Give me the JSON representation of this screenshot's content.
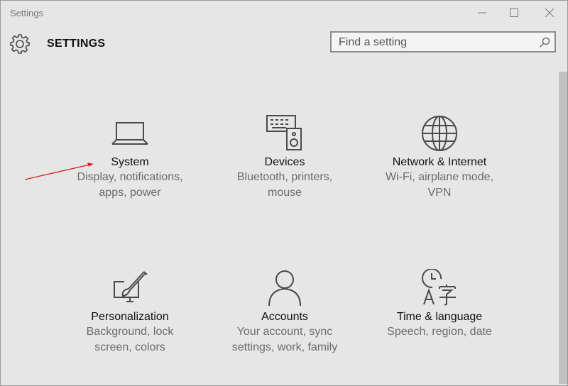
{
  "window": {
    "title": "Settings"
  },
  "header": {
    "title": "SETTINGS"
  },
  "search": {
    "placeholder": "Find a setting"
  },
  "tiles": [
    {
      "title": "System",
      "desc": "Display, notifications, apps, power",
      "icon": "laptop-icon"
    },
    {
      "title": "Devices",
      "desc": "Bluetooth, printers, mouse",
      "icon": "devices-icon"
    },
    {
      "title": "Network & Internet",
      "desc": "Wi-Fi, airplane mode, VPN",
      "icon": "globe-icon"
    },
    {
      "title": "Personalization",
      "desc": "Background, lock screen, colors",
      "icon": "personalization-icon"
    },
    {
      "title": "Accounts",
      "desc": "Your account, sync settings, work, family",
      "icon": "person-icon"
    },
    {
      "title": "Time & language",
      "desc": "Speech, region, date",
      "icon": "time-language-icon"
    }
  ],
  "colors": {
    "background": "#e6e6e6",
    "arrow": "#d42020",
    "icon": "#4a4a4a"
  }
}
